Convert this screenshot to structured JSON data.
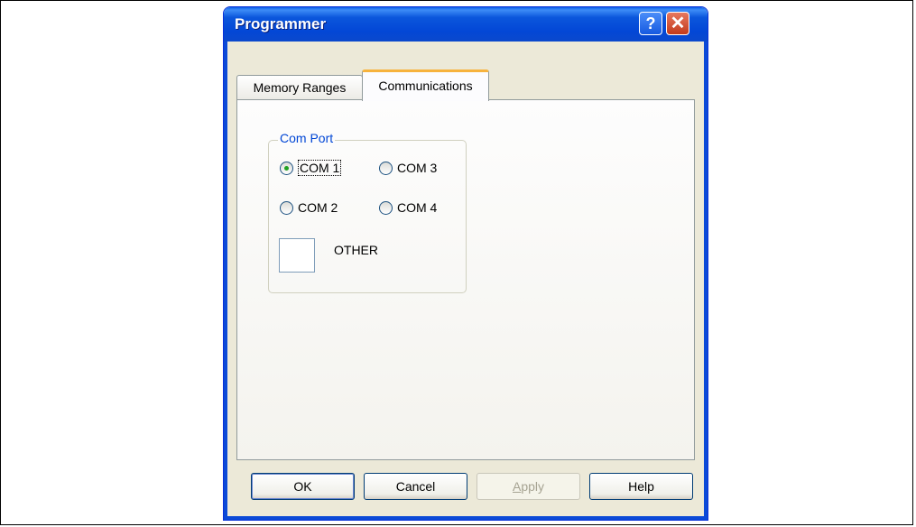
{
  "window": {
    "title": "Programmer",
    "help_glyph": "?",
    "close_glyph": "✕"
  },
  "tabs": [
    {
      "label": "Memory Ranges",
      "selected": false
    },
    {
      "label": "Communications",
      "selected": true
    }
  ],
  "com_port": {
    "group_title": "Com Port",
    "options": [
      {
        "label": "COM 1",
        "checked": true
      },
      {
        "label": "COM 3",
        "checked": false
      },
      {
        "label": "COM 2",
        "checked": false
      },
      {
        "label": "COM 4",
        "checked": false
      }
    ],
    "other_label": "OTHER",
    "other_value": ""
  },
  "buttons": {
    "ok": "OK",
    "cancel": "Cancel",
    "apply_first": "A",
    "apply_rest": "pply",
    "help": "Help"
  },
  "colors": {
    "titlebar": "#0347d6",
    "group_title": "#0046d5",
    "tab_highlight": "#f7b33d",
    "radio_dot": "#21a121"
  }
}
